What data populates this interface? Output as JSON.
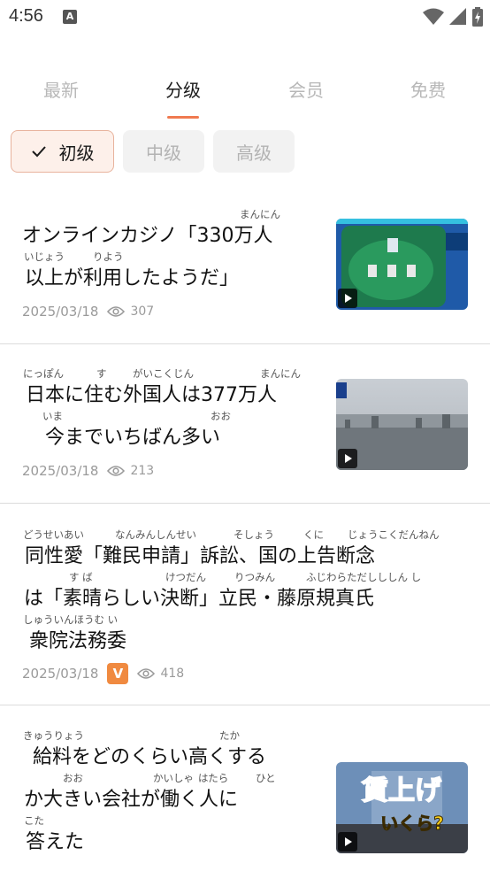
{
  "status": {
    "time": "4:56",
    "notif_label": "A"
  },
  "tabs": [
    {
      "label": "最新",
      "active": false
    },
    {
      "label": "分级",
      "active": true
    },
    {
      "label": "会员",
      "active": false
    },
    {
      "label": "免费",
      "active": false
    }
  ],
  "levels": [
    {
      "label": "初级",
      "selected": true
    },
    {
      "label": "中级",
      "selected": false
    },
    {
      "label": "高级",
      "selected": false
    }
  ],
  "articles": [
    {
      "rubies": [
        "まんにん",
        "いじょう",
        "りよう"
      ],
      "lines": [
        "オンラインカジノ「330万人",
        "以上が利用したようだ」"
      ],
      "date": "2025/03/18",
      "views": "307",
      "vip": false,
      "has_thumb": true
    },
    {
      "rubies": [
        "にっぽん",
        "す",
        "がいこくじん",
        "まんにん",
        "いま",
        "おお"
      ],
      "lines": [
        "日本に住む外国人は377万人",
        "今までいちばん多い"
      ],
      "date": "2025/03/18",
      "views": "213",
      "vip": false,
      "has_thumb": true
    },
    {
      "rubies": [
        "どうせいあい",
        "なんみんしんせい",
        "そしょう",
        "くに",
        "じょうこくだんねん",
        "す ば",
        "けつだん",
        "りつみん",
        "ふじわらただしししん し",
        "しゅういんほうむ い"
      ],
      "lines": [
        "同性愛「難民申請」訴訟、国の上告断念",
        "は「素晴らしい決断」立民・藤原規真氏",
        "衆院法務委"
      ],
      "date": "2025/03/18",
      "views": "418",
      "vip": true,
      "vip_label": "V",
      "has_thumb": false
    },
    {
      "rubies": [
        "きゅうりょう",
        "たか",
        "おお",
        "かいしゃ",
        "はたら",
        "ひと",
        "こた"
      ],
      "lines": [
        "給料をどのくらい高くする",
        "か大きい会社が働く人に",
        "答えた"
      ],
      "thumb_text": [
        "賃上げ",
        "いくら?"
      ],
      "has_thumb": true
    }
  ]
}
